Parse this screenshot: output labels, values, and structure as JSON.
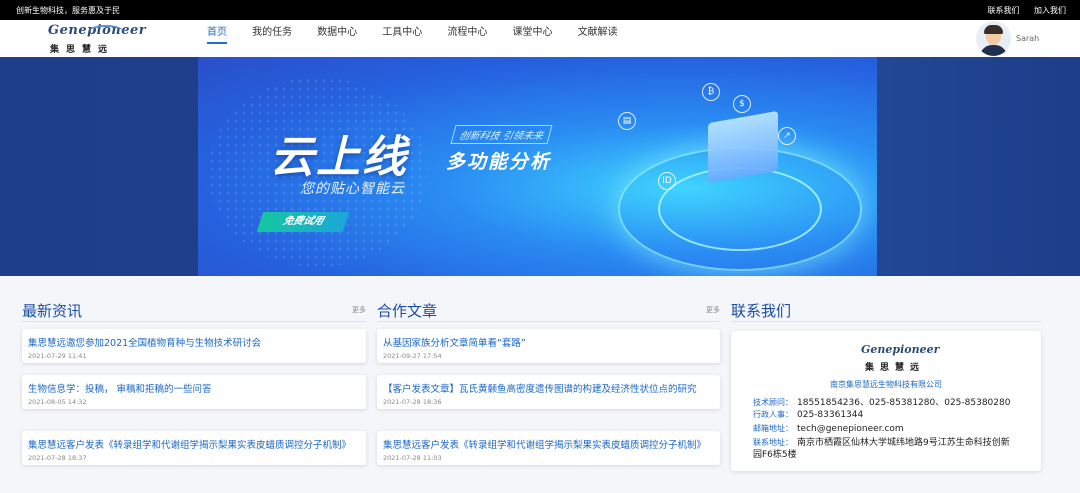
{
  "topbar": {
    "slogan": "创新生物科技，服务惠及于民",
    "contact_us": "联系我们",
    "join_us": "加入我们"
  },
  "logo": {
    "en": "Genepioneer",
    "cn": "集思慧远"
  },
  "nav": {
    "items": [
      {
        "label": "首页",
        "active": true
      },
      {
        "label": "我的任务",
        "active": false
      },
      {
        "label": "数据中心",
        "active": false
      },
      {
        "label": "工具中心",
        "active": false
      },
      {
        "label": "流程中心",
        "active": false
      },
      {
        "label": "课堂中心",
        "active": false
      },
      {
        "label": "文献解读",
        "active": false
      }
    ]
  },
  "user": {
    "name": "Sarah"
  },
  "banner": {
    "main": "云上线",
    "tag": "创新科技 引领未来",
    "sub": "多功能分析",
    "sub2": "您的贴心智能云",
    "button": "免费试用"
  },
  "news": {
    "title": "最新资讯",
    "more": "更多",
    "items": [
      {
        "title": "集思慧远邀您参加2021全国植物育种与生物技术研讨会",
        "date": "2021-07-29 11:41"
      },
      {
        "title": "生物信息学：投稿， 审稿和拒稿的一些问答",
        "date": "2021-08-05 14:32"
      },
      {
        "title": "集思慧远客户发表《转录组学和代谢组学揭示梨果实表皮蜡质调控分子机制》",
        "date": "2021-07-28 18:37"
      }
    ]
  },
  "articles": {
    "title": "合作文章",
    "more": "更多",
    "items": [
      {
        "title": "从基因家族分析文章简单看“套路”",
        "date": "2021-09-27 17:54"
      },
      {
        "title": "【客户发表文章】瓦氏黄颡鱼高密度遗传图谱的构建及经济性状位点的研究",
        "date": "2021-07-28 18:36"
      },
      {
        "title": "集思慧远客户发表《转录组学和代谢组学揭示梨果实表皮蜡质调控分子机制》",
        "date": "2021-07-28 11:03"
      }
    ]
  },
  "contact": {
    "title": "联系我们",
    "company": "南京集思慧远生物科技有限公司",
    "tech_label": "技术顾问：",
    "tech_value": "18551854236、025-85381280、025-85380280",
    "admin_label": "行政人事：",
    "admin_value": "025-83361344",
    "email_label": "邮箱地址：",
    "email_value": "tech@genepioneer.com",
    "addr_label": "联系地址：",
    "addr_value": "南京市栖霞区仙林大学城纬地路9号江苏生命科技创新园F6栋5楼"
  },
  "colors": {
    "accent": "#1a6fd6",
    "topbar": "#000000",
    "banner_side": "#1f3f8c"
  }
}
